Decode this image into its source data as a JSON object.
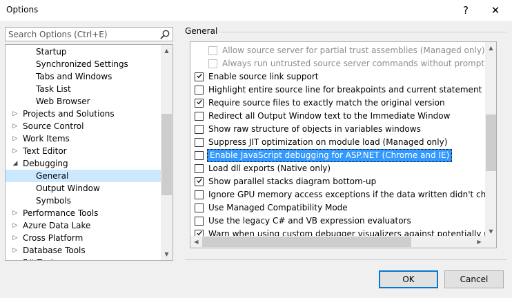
{
  "window": {
    "title": "Options",
    "help_label": "?",
    "close_label": "✕"
  },
  "search": {
    "placeholder": "Search Options (Ctrl+E)"
  },
  "tree": {
    "items": [
      {
        "label": "Startup",
        "level": 2,
        "arrow": ""
      },
      {
        "label": "Synchronized Settings",
        "level": 2,
        "arrow": ""
      },
      {
        "label": "Tabs and Windows",
        "level": 2,
        "arrow": ""
      },
      {
        "label": "Task List",
        "level": 2,
        "arrow": ""
      },
      {
        "label": "Web Browser",
        "level": 2,
        "arrow": ""
      },
      {
        "label": "Projects and Solutions",
        "level": 1,
        "arrow": "▷"
      },
      {
        "label": "Source Control",
        "level": 1,
        "arrow": "▷"
      },
      {
        "label": "Work Items",
        "level": 1,
        "arrow": "▷"
      },
      {
        "label": "Text Editor",
        "level": 1,
        "arrow": "▷"
      },
      {
        "label": "Debugging",
        "level": 1,
        "arrow": "◢"
      },
      {
        "label": "General",
        "level": 2,
        "arrow": "",
        "selected": true
      },
      {
        "label": "Output Window",
        "level": 2,
        "arrow": ""
      },
      {
        "label": "Symbols",
        "level": 2,
        "arrow": ""
      },
      {
        "label": "Performance Tools",
        "level": 1,
        "arrow": "▷"
      },
      {
        "label": "Azure Data Lake",
        "level": 1,
        "arrow": "▷"
      },
      {
        "label": "Cross Platform",
        "level": 1,
        "arrow": "▷"
      },
      {
        "label": "Database Tools",
        "level": 1,
        "arrow": "▷"
      },
      {
        "label": "F# Tools",
        "level": 1,
        "arrow": "▷"
      }
    ]
  },
  "general": {
    "title": "General",
    "options": [
      {
        "label": "Allow source server for partial trust assemblies (Managed only)",
        "checked": false,
        "disabled": true,
        "indent": 1
      },
      {
        "label": "Always run untrusted source server commands without prompting",
        "checked": false,
        "disabled": true,
        "indent": 1
      },
      {
        "label": "Enable source link support",
        "checked": true,
        "disabled": false,
        "indent": 0
      },
      {
        "label": "Highlight entire source line for breakpoints and current statement (C++ only)",
        "checked": false,
        "disabled": false,
        "indent": 0
      },
      {
        "label": "Require source files to exactly match the original version",
        "checked": true,
        "disabled": false,
        "indent": 0
      },
      {
        "label": "Redirect all Output Window text to the Immediate Window",
        "checked": false,
        "disabled": false,
        "indent": 0
      },
      {
        "label": "Show raw structure of objects in variables windows",
        "checked": false,
        "disabled": false,
        "indent": 0
      },
      {
        "label": "Suppress JIT optimization on module load (Managed only)",
        "checked": false,
        "disabled": false,
        "indent": 0
      },
      {
        "label": "Enable JavaScript debugging for ASP.NET (Chrome and IE)",
        "checked": false,
        "disabled": false,
        "indent": 0,
        "highlight": true
      },
      {
        "label": "Load dll exports (Native only)",
        "checked": false,
        "disabled": false,
        "indent": 0
      },
      {
        "label": "Show parallel stacks diagram bottom-up",
        "checked": true,
        "disabled": false,
        "indent": 0
      },
      {
        "label": "Ignore GPU memory access exceptions if the data written didn't change the value",
        "checked": false,
        "disabled": false,
        "indent": 0
      },
      {
        "label": "Use Managed Compatibility Mode",
        "checked": false,
        "disabled": false,
        "indent": 0
      },
      {
        "label": "Use the legacy C# and VB expression evaluators",
        "checked": false,
        "disabled": false,
        "indent": 0
      },
      {
        "label": "Warn when using custom debugger visualizers against potentially unsafe processes",
        "checked": true,
        "disabled": false,
        "indent": 0
      }
    ]
  },
  "buttons": {
    "ok_label": "OK",
    "cancel_label": "Cancel"
  },
  "colors": {
    "selection_bg": "#cce8ff",
    "highlight_bg": "#3399ff",
    "default_button_border": "#0078d7"
  }
}
